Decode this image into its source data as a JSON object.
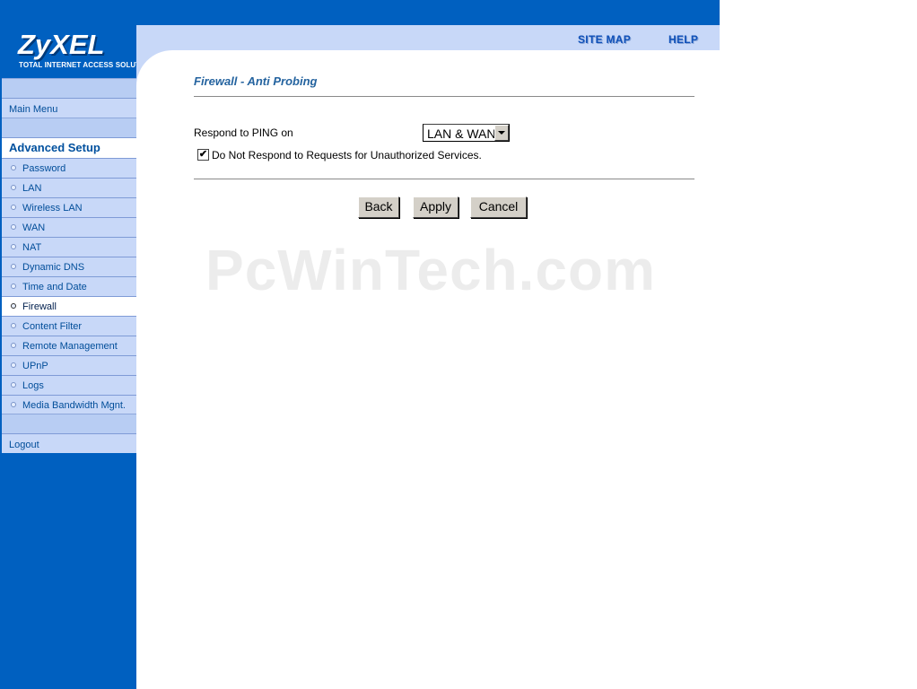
{
  "brand": {
    "name": "ZyXEL",
    "tagline": "Total Internet Access Solution"
  },
  "header": {
    "site_map": "SITE MAP",
    "help": "HELP"
  },
  "sidebar": {
    "main_menu": "Main Menu",
    "section_title": "Advanced Setup",
    "items": [
      {
        "label": "Password"
      },
      {
        "label": "LAN"
      },
      {
        "label": "Wireless LAN"
      },
      {
        "label": "WAN"
      },
      {
        "label": "NAT"
      },
      {
        "label": "Dynamic DNS"
      },
      {
        "label": "Time and Date"
      },
      {
        "label": "Firewall",
        "active": true
      },
      {
        "label": "Content Filter"
      },
      {
        "label": "Remote Management"
      },
      {
        "label": "UPnP"
      },
      {
        "label": "Logs"
      },
      {
        "label": "Media Bandwidth Mgnt."
      }
    ],
    "logout": "Logout"
  },
  "main": {
    "title": "Firewall - Anti Probing",
    "ping_label": "Respond to PING on",
    "ping_value": "LAN & WAN",
    "unauth_checked": true,
    "unauth_label": "Do Not Respond to Requests for Unauthorized Services.",
    "buttons": {
      "back": "Back",
      "apply": "Apply",
      "cancel": "Cancel"
    }
  },
  "watermark": "PcWinTech.com",
  "colors": {
    "sidebar_blue": "#0060c0",
    "nav_light": "#c8d8f8",
    "title_blue": "#24639f"
  }
}
